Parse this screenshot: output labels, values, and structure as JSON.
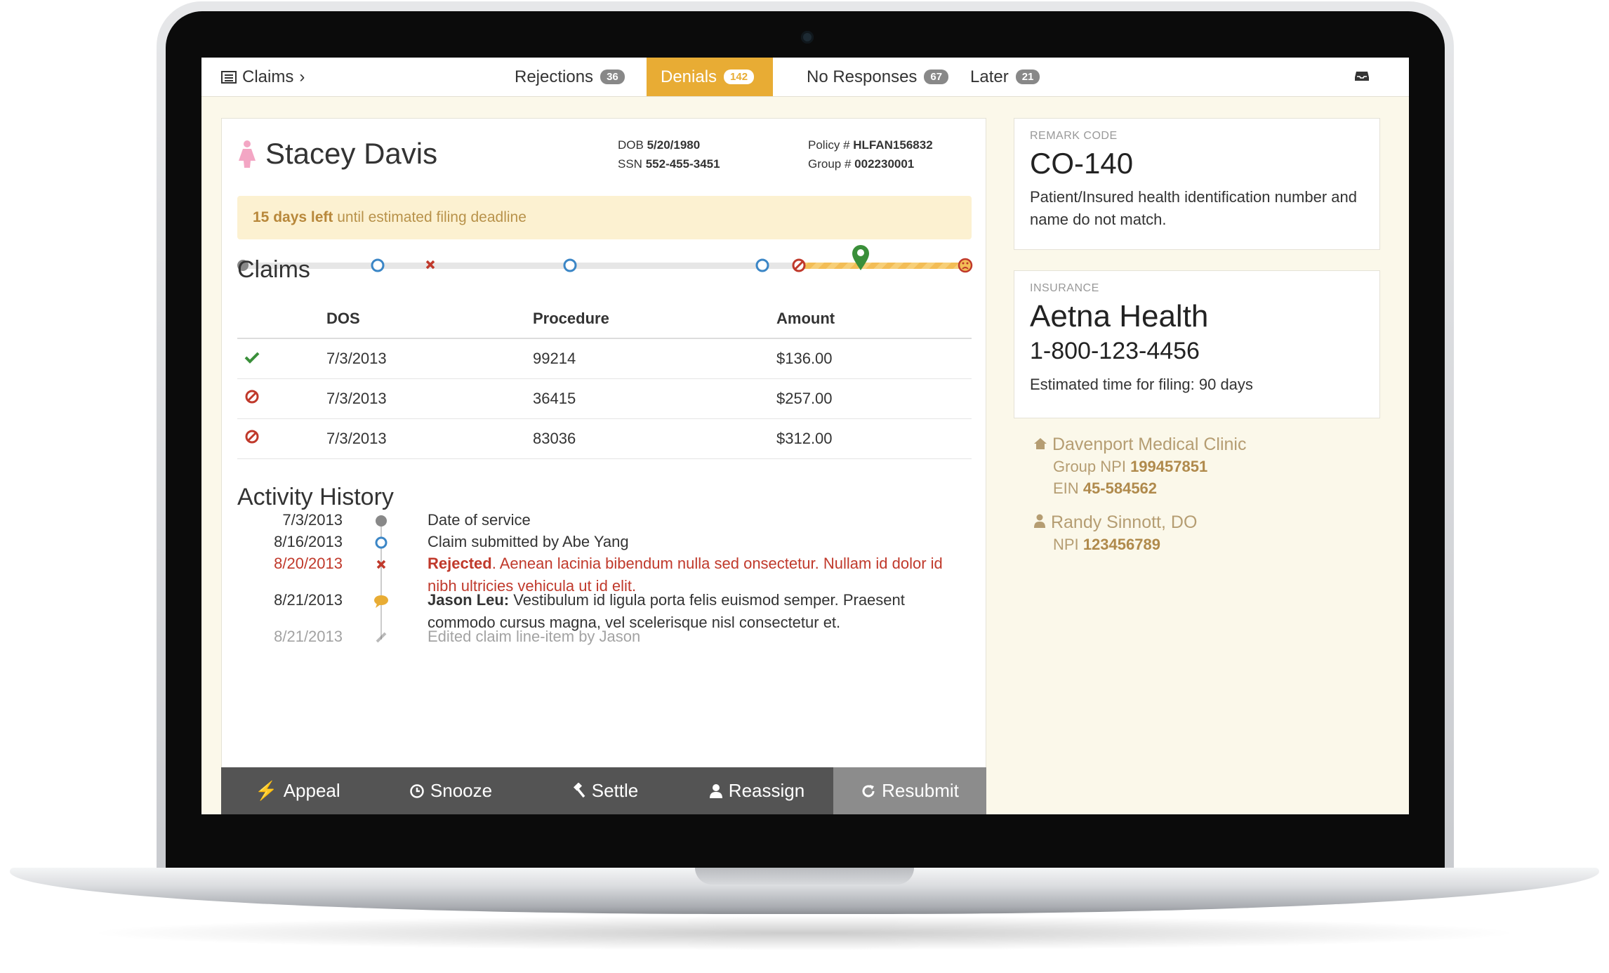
{
  "nav": {
    "breadcrumb": "Claims",
    "tabs": [
      {
        "label": "Rejections",
        "count": "36"
      },
      {
        "label": "Denials",
        "count": "142"
      },
      {
        "label": "No Responses",
        "count": "67"
      },
      {
        "label": "Later",
        "count": "21"
      }
    ],
    "active_tab": "Denials"
  },
  "patient": {
    "name": "Stacey Davis",
    "dob_label": "DOB",
    "dob": "5/20/1980",
    "ssn_label": "SSN",
    "ssn": "552-455-3451",
    "policy_label": "Policy #",
    "policy": "HLFAN156832",
    "group_label": "Group #",
    "group": "002230001"
  },
  "deadline": {
    "strong": "15 days left",
    "rest": " until estimated filing deadline"
  },
  "claims": {
    "title": "Claims",
    "headers": [
      "DOS",
      "Procedure",
      "Amount"
    ],
    "rows": [
      {
        "status": "paid",
        "dos": "7/3/2013",
        "procedure": "99214",
        "amount": "$136.00"
      },
      {
        "status": "denied",
        "dos": "7/3/2013",
        "procedure": "36415",
        "amount": "$257.00"
      },
      {
        "status": "denied",
        "dos": "7/3/2013",
        "procedure": "83036",
        "amount": "$312.00"
      }
    ]
  },
  "activity": {
    "title": "Activity History",
    "items": [
      {
        "date": "7/3/2013",
        "text": "Date of service"
      },
      {
        "date": "8/16/2013",
        "text": "Claim submitted by Abe Yang"
      },
      {
        "date": "8/20/2013",
        "strong": "Rejected",
        "text": ". Aenean lacinia bibendum nulla sed onsectetur. Nullam id dolor id nibh ultricies vehicula ut id elit."
      },
      {
        "date": "8/21/2013",
        "strong": "Jason Leu:",
        "text": " Vestibulum id ligula porta felis euismod semper. Praesent commodo cursus magna, vel scelerisque nisl consectetur et."
      },
      {
        "date": "8/21/2013",
        "text": "Edited claim line-item by Jason"
      }
    ]
  },
  "actions": [
    "Appeal",
    "Snooze",
    "Settle",
    "Reassign",
    "Resubmit"
  ],
  "remark": {
    "label": "REMARK CODE",
    "code": "CO-140",
    "description": "Patient/Insured health identification number and name do not match."
  },
  "insurance": {
    "label": "INSURANCE",
    "name": "Aetna Health",
    "phone": "1-800-123-4456",
    "filing": "Estimated time for filing: 90 days"
  },
  "clinic": {
    "name": "Davenport Medical Clinic",
    "npi_label": "Group NPI",
    "npi": "199457851",
    "ein_label": "EIN",
    "ein": "45-584562"
  },
  "provider": {
    "name": "Randy Sinnott, DO",
    "npi_label": "NPI",
    "npi": "123456789"
  },
  "colors": {
    "accent": "#e8ac34",
    "red": "#c0392b",
    "green": "#3a8f3a",
    "blue": "#3b86c6"
  }
}
